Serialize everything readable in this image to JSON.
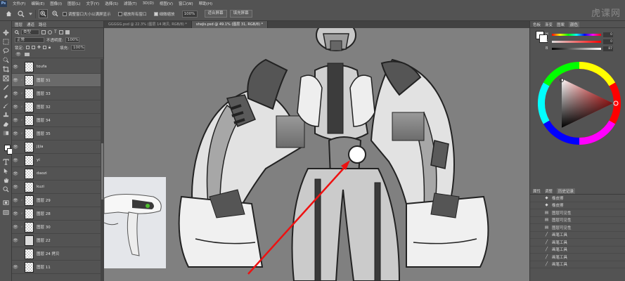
{
  "app": {
    "logo": "Ps"
  },
  "menu": [
    "文件(F)",
    "编辑(E)",
    "图像(I)",
    "图层(L)",
    "文字(Y)",
    "选择(S)",
    "滤镜(T)",
    "3D(D)",
    "视图(V)",
    "窗口(W)",
    "帮助(H)"
  ],
  "options": {
    "resize_windows": "调整窗口大小以满屏显示",
    "zoom_all": "缩放所有窗口",
    "scrubby_zoom": "细微缩放",
    "zoom_value": "100%",
    "fit_screen": "适合屏幕",
    "fill_screen": "填充屏幕"
  },
  "layers_panel": {
    "tabs": [
      "图层",
      "通道",
      "路径"
    ],
    "filter_type": "类型",
    "blend_mode": "正常",
    "opacity_label": "不透明度:",
    "opacity_value": "100%",
    "lock_label": "锁定:",
    "fill_label": "填充:",
    "fill_value": "100%",
    "items": [
      {
        "name": "toufa",
        "selected": false
      },
      {
        "name": "图层 31",
        "selected": true
      },
      {
        "name": "图层 33",
        "selected": false
      },
      {
        "name": "图层 32",
        "selected": false
      },
      {
        "name": "图层 34",
        "selected": false
      },
      {
        "name": "图层 35",
        "selected": false
      },
      {
        "name": "jijia",
        "selected": false
      },
      {
        "name": "yi",
        "selected": false
      },
      {
        "name": "daozi",
        "selected": false
      },
      {
        "name": "kuzi",
        "selected": false
      },
      {
        "name": "图层 29",
        "selected": false
      },
      {
        "name": "图层 28",
        "selected": false
      },
      {
        "name": "图层 30",
        "selected": false
      },
      {
        "name": "图层 22",
        "selected": false
      },
      {
        "name": "图层 24 拷贝",
        "selected": false
      },
      {
        "name": "图层 11",
        "selected": false
      }
    ]
  },
  "documents": {
    "tabs": [
      {
        "label": "GGGGG.psd @ 22.3% (图层 14 拷贝, RGB/8) *",
        "active": false
      },
      {
        "label": "shejis.psd @ 49.1% (图层 31, RGB/8) *",
        "active": true
      }
    ]
  },
  "color_panel": {
    "tabs": [
      "色板",
      "渐变",
      "图案",
      "颜色"
    ],
    "channels": [
      {
        "label": "H",
        "value": "0"
      },
      {
        "label": "S",
        "value": "0"
      },
      {
        "label": "B",
        "value": "87"
      }
    ],
    "accent": "#ff1f1f"
  },
  "history_panel": {
    "tabs": [
      "属性",
      "调整",
      "历史记录"
    ],
    "items": [
      "橡皮擦",
      "橡皮擦",
      "图层可见性",
      "图层可见性",
      "图层可见性",
      "画笔工具",
      "画笔工具",
      "画笔工具",
      "画笔工具",
      "画笔工具"
    ]
  },
  "watermark": "虎课网"
}
